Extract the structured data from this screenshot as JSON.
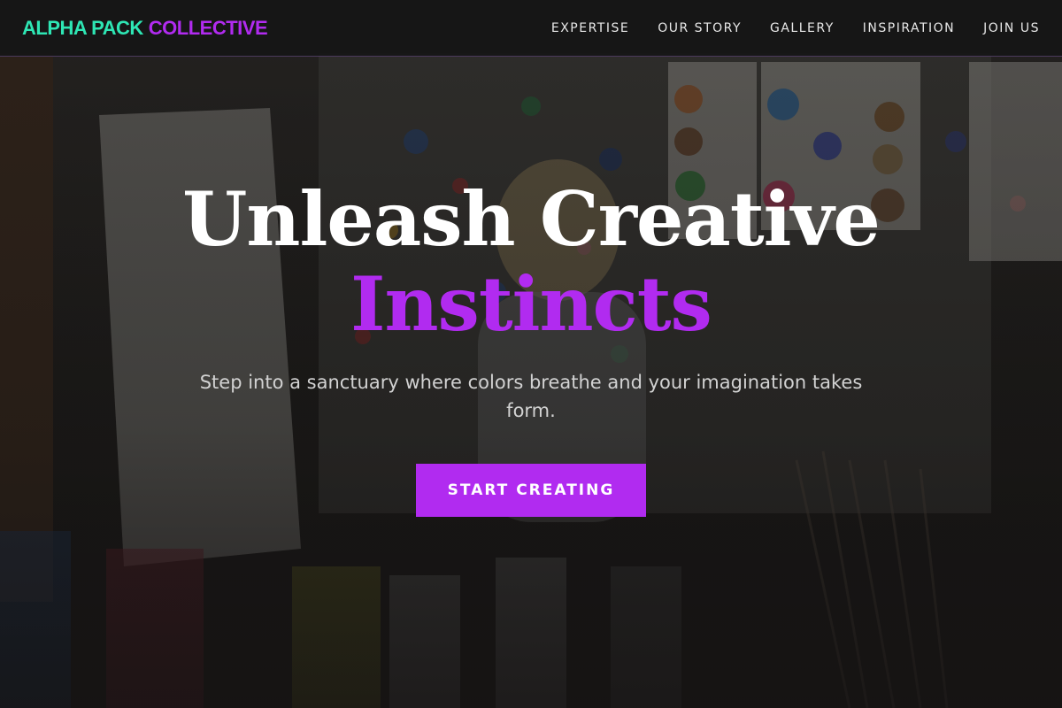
{
  "brand": {
    "part1": "ALPHA PACK",
    "part2": "COLLECTIVE"
  },
  "nav": {
    "items": [
      {
        "label": "EXPERTISE"
      },
      {
        "label": "OUR STORY"
      },
      {
        "label": "GALLERY"
      },
      {
        "label": "INSPIRATION"
      },
      {
        "label": "JOIN US"
      }
    ]
  },
  "hero": {
    "title_line1": "Unleash Creative",
    "title_line2": "Instincts",
    "subtitle": "Step into a sanctuary where colors breathe and your imagination takes form.",
    "cta_label": "START CREATING",
    "background_description_icon": "art-studio-photo"
  },
  "colors": {
    "brand_teal": "#2ee6b4",
    "brand_purple": "#b12bf0",
    "nav_bg": "#161616",
    "text_light": "#d2d2d2"
  }
}
